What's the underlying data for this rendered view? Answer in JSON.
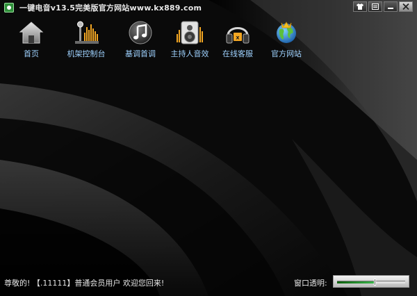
{
  "window": {
    "title": "一键电音v13.5完美版官方网站www.kx889.com"
  },
  "window_controls": [
    {
      "name": "skin-button",
      "icon": "tshirt-icon"
    },
    {
      "name": "menu-button",
      "icon": "menu-icon"
    },
    {
      "name": "minimize-button",
      "icon": "minimize-icon"
    },
    {
      "name": "close-button",
      "icon": "close-icon"
    }
  ],
  "toolbar": {
    "items": [
      {
        "label": "首页",
        "icon": "home-icon"
      },
      {
        "label": "机架控制台",
        "icon": "mixer-icon"
      },
      {
        "label": "基调首调",
        "icon": "music-note-icon"
      },
      {
        "label": "主持人音效",
        "icon": "speaker-icon"
      },
      {
        "label": "在线客服",
        "icon": "headphones-icon"
      },
      {
        "label": "官方网站",
        "icon": "globe-icon"
      }
    ]
  },
  "status": {
    "message": "尊敬的! 【.11111】普通会员用户 欢迎您回来!",
    "opacity_label": "窗口透明:",
    "opacity_value": 0.55
  },
  "colors": {
    "background": "#0b0b0b",
    "label": "#9fd2ff",
    "slider_fill": "#39b54a"
  }
}
